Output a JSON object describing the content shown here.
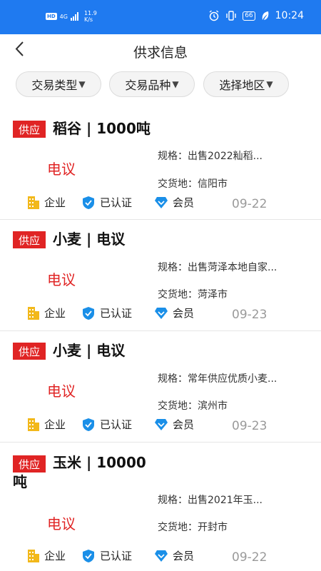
{
  "status_bar": {
    "hd": "HD",
    "network": "4G",
    "speed_value": "11.9",
    "speed_unit": "K/s",
    "battery": "66",
    "time": "10:24"
  },
  "header": {
    "title": "供求信息"
  },
  "filters": [
    {
      "label": "交易类型"
    },
    {
      "label": "交易品种"
    },
    {
      "label": "选择地区"
    }
  ],
  "meta_labels": {
    "enterprise": "企业",
    "certified": "已认证",
    "member": "会员"
  },
  "colors": {
    "status_bar": "#1f7af0",
    "supply_tag": "#e02424",
    "price": "#e02424",
    "enterprise_icon": "#f2b81a",
    "cert_icon": "#1a8fe8",
    "member_icon": "#1a8fe8"
  },
  "listings": [
    {
      "tag": "供应",
      "title": "稻谷 | 1000吨",
      "price": "电议",
      "spec": "规格：出售2022籼稻...",
      "place": "交货地：信阳市",
      "date": "09-22"
    },
    {
      "tag": "供应",
      "title": "小麦 | 电议",
      "price": "电议",
      "spec": "规格：出售菏泽本地自家...",
      "place": "交货地：菏泽市",
      "date": "09-23"
    },
    {
      "tag": "供应",
      "title": "小麦 | 电议",
      "price": "电议",
      "spec": "规格：常年供应优质小麦...",
      "place": "交货地：滨州市",
      "date": "09-23"
    },
    {
      "tag": "供应",
      "title": "玉米 | 10000吨",
      "price": "电议",
      "spec": "规格：出售2021年玉...",
      "place": "交货地：开封市",
      "date": "09-22"
    }
  ]
}
